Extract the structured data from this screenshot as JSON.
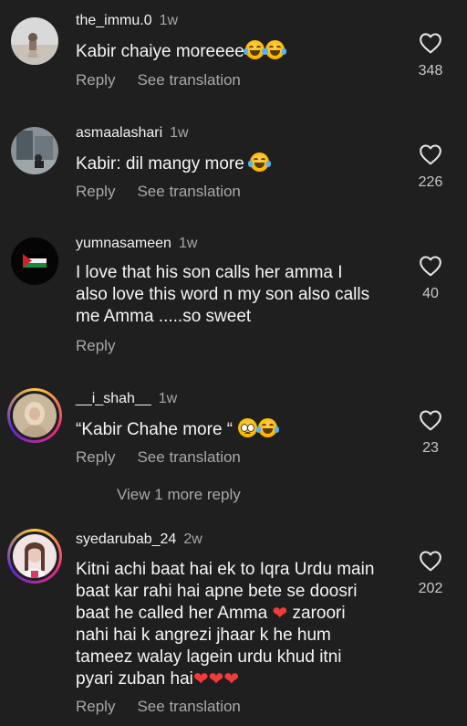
{
  "comments": [
    {
      "username": "the_immu.0",
      "time": "1w",
      "text": "Kabir chaiye moreeee",
      "reply_label": "Reply",
      "translate_label": "See translation",
      "likes": "348",
      "emoji": [
        "joy",
        "joy"
      ]
    },
    {
      "username": "asmaalashari",
      "time": "1w",
      "text": "Kabir: dil mangy more",
      "reply_label": "Reply",
      "translate_label": "See translation",
      "likes": "226",
      "emoji": [
        "joy"
      ]
    },
    {
      "username": "yumnasameen",
      "time": "1w",
      "text_lines": [
        "I love that his son calls her amma I",
        "also love this word n my son also calls",
        "me Amma .....so sweet"
      ],
      "reply_label": "Reply",
      "likes": "40"
    },
    {
      "username": "__i_shah__",
      "time": "1w",
      "text": "“Kabir Chahe more “",
      "reply_label": "Reply",
      "translate_label": "See translation",
      "likes": "23",
      "emoji": [
        "pleading",
        "joy"
      ],
      "view_more": "View 1 more reply"
    },
    {
      "username": "syedarubab_24",
      "time": "2w",
      "text_lines": [
        "Kitni achi baat hai ek to Iqra Urdu main",
        "baat kar rahi hai apne bete se doosri",
        "baat he called her Amma",
        "zaroori",
        "nahi hai k angrezi jhaar k he hum",
        "tameez walay lagein urdu khud itni",
        "pyari zuban hai"
      ],
      "reply_label": "Reply",
      "translate_label": "See translation",
      "likes": "202"
    }
  ],
  "icons": {
    "like": "heart-outline-icon",
    "heart_emoji": "❤",
    "colors": {
      "background": "#1f1f1f",
      "muted": "#a8a8a8",
      "heart": "#f23b3b"
    }
  }
}
